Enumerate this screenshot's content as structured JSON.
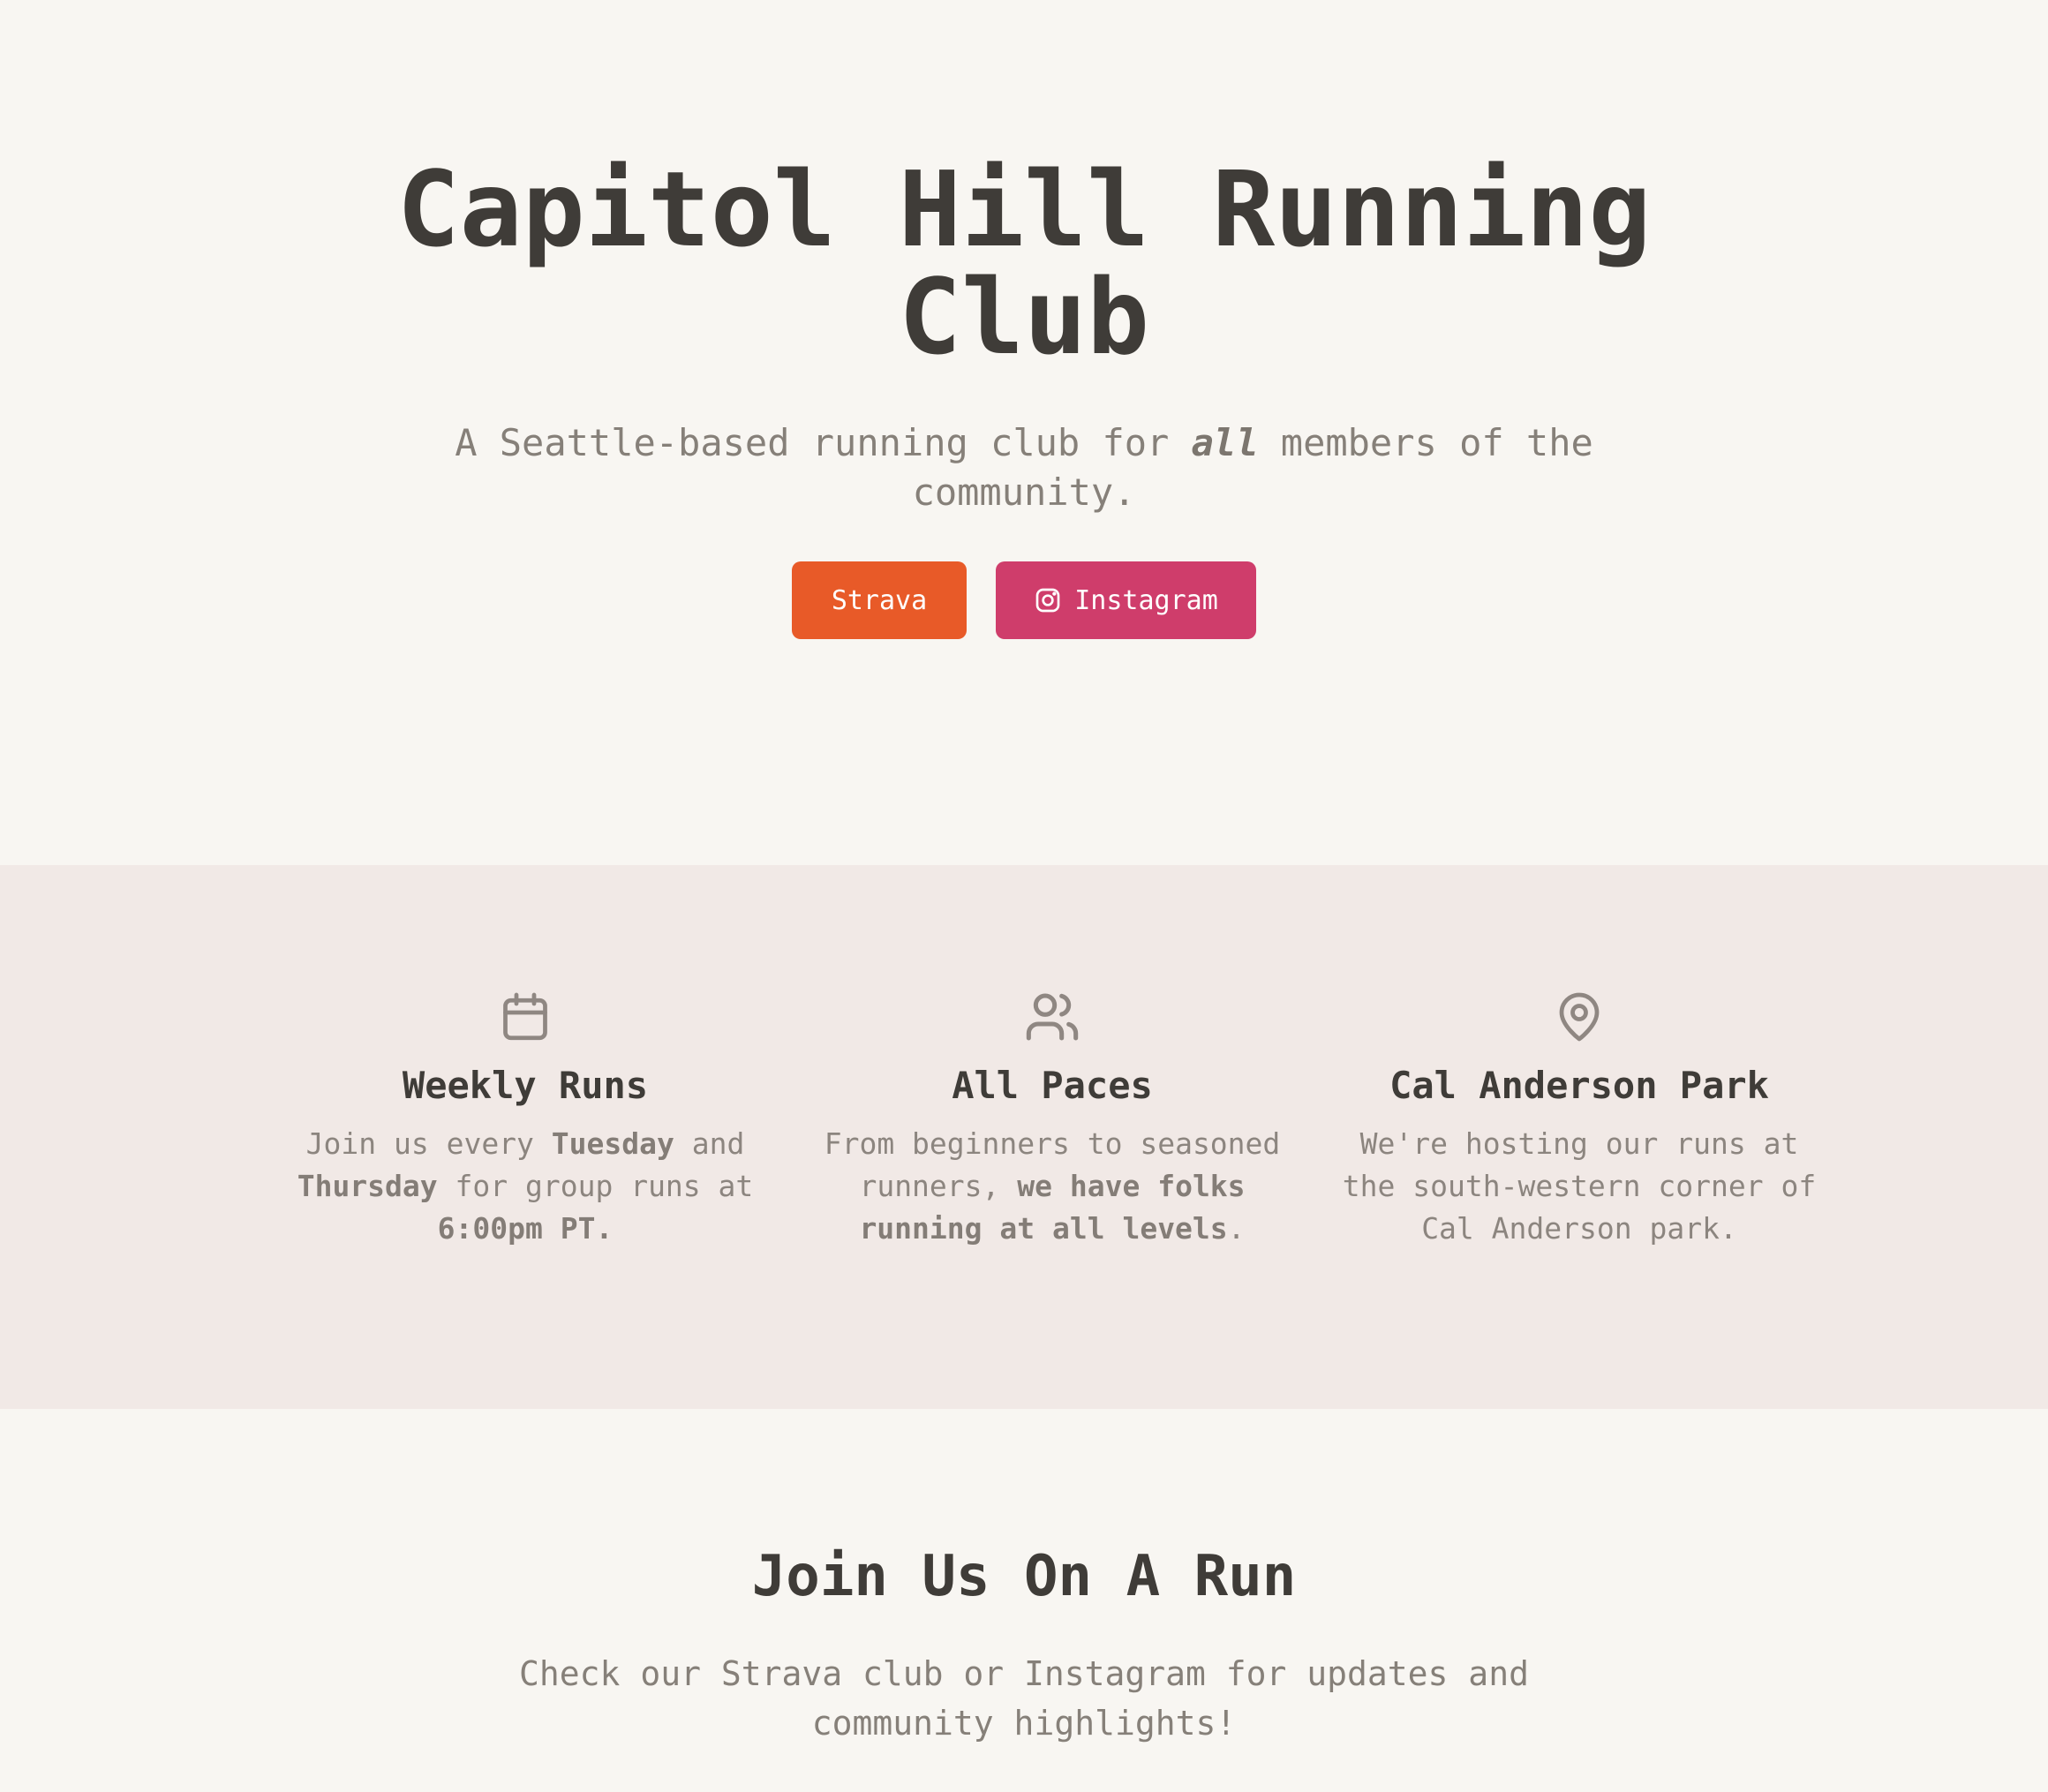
{
  "hero": {
    "title": "Capitol Hill Running Club",
    "subtitle_before": "A Seattle-based running club for ",
    "subtitle_emphasis": "all",
    "subtitle_after": " members of the community.",
    "buttons": {
      "strava_label": "Strava",
      "instagram_label": "Instagram",
      "instagram_icon": "instagram-icon"
    }
  },
  "features": [
    {
      "icon": "calendar-icon",
      "title": "Weekly Runs",
      "desc_parts": [
        "Join us every ",
        "Tuesday",
        " and ",
        "Thursday",
        " for group runs at ",
        "6:00pm PT."
      ]
    },
    {
      "icon": "users-icon",
      "title": "All Paces",
      "desc_parts": [
        "From beginners to seasoned runners, ",
        "we have folks running at all levels",
        "."
      ]
    },
    {
      "icon": "map-pin-icon",
      "title": "Cal Anderson Park",
      "desc": "We're hosting our runs at the south-western corner of Cal Anderson park."
    }
  ],
  "join": {
    "title": "Join Us On A Run",
    "description": "Check our Strava club or Instagram for updates and community highlights!"
  },
  "colors": {
    "strava": "#e85a28",
    "instagram": "#cf3d6b",
    "background": "#f8f6f2",
    "feature_band": "#f1e9e6"
  }
}
